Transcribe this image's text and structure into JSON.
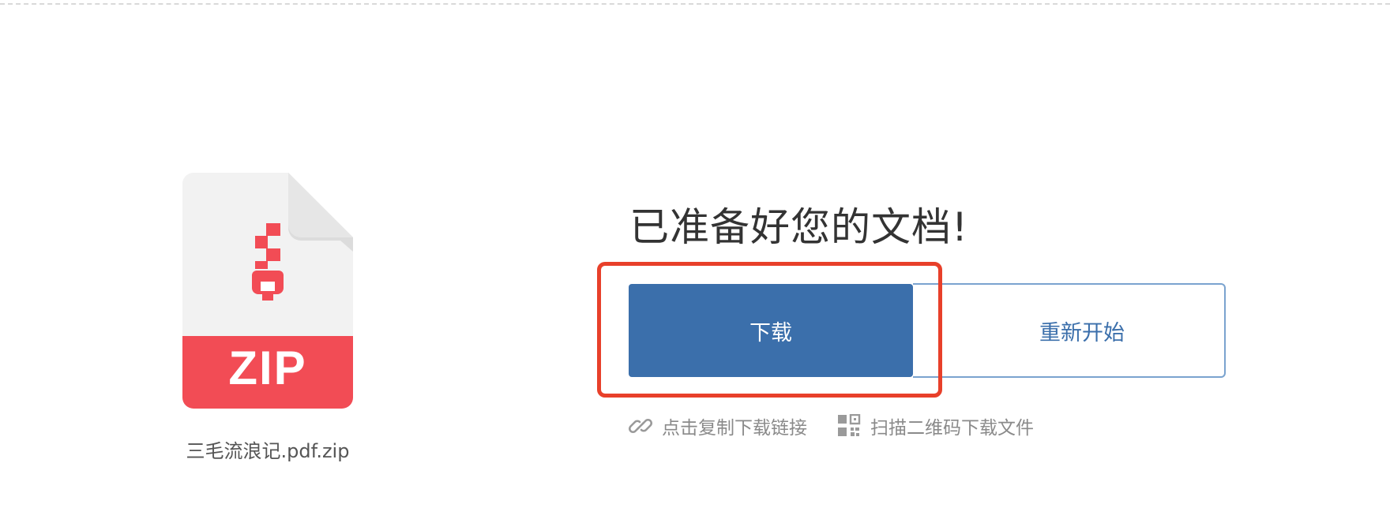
{
  "file": {
    "type_label": "ZIP",
    "name": "三毛流浪记.pdf.zip",
    "icon": "zip-file-icon",
    "accent_color": "#f24c55"
  },
  "main": {
    "title": "已准备好您的文档!",
    "download_label": "下载",
    "restart_label": "重新开始",
    "copy_link_label": "点击复制下载链接",
    "copy_link_icon": "link-icon",
    "qr_label": "扫描二维码下载文件",
    "qr_icon": "qr-code-icon"
  },
  "colors": {
    "primary": "#3b6fab",
    "highlight": "#e8402a",
    "muted_text": "#8a8a8a"
  }
}
